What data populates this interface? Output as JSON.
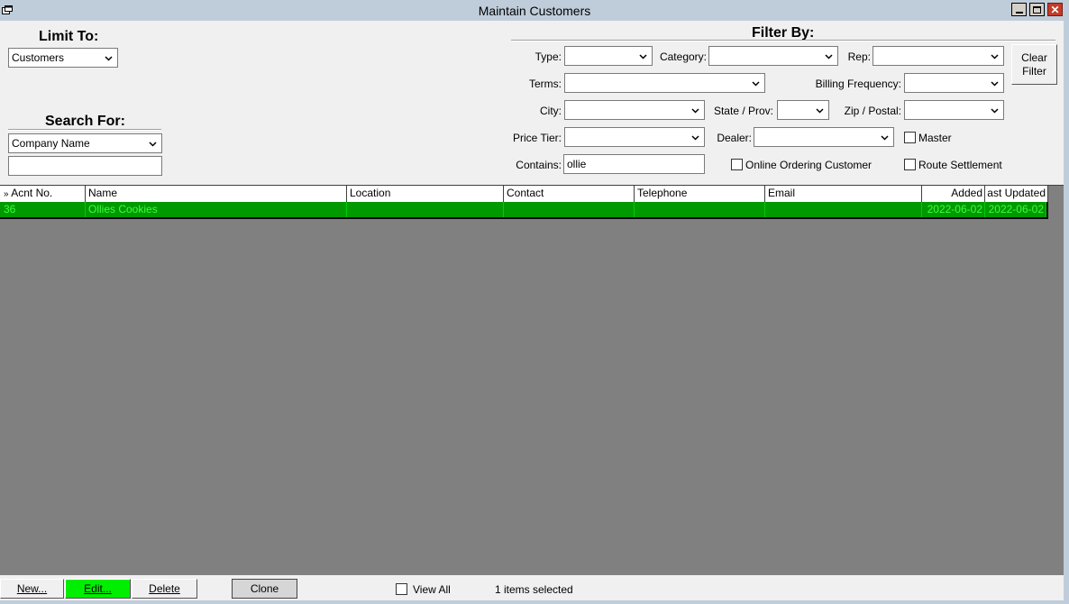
{
  "window": {
    "title": "Maintain Customers"
  },
  "limit_to": {
    "heading": "Limit To:",
    "value": "Customers"
  },
  "search_for": {
    "heading": "Search For:",
    "field": "Company Name",
    "value": ""
  },
  "filter_by": {
    "heading": "Filter By:",
    "type_label": "Type:",
    "type_value": "",
    "category_label": "Category:",
    "category_value": "",
    "rep_label": "Rep:",
    "rep_value": "",
    "terms_label": "Terms:",
    "terms_value": "",
    "billing_frequency_label": "Billing Frequency:",
    "billing_frequency_value": "",
    "city_label": "City:",
    "city_value": "",
    "state_label": "State / Prov:",
    "state_value": "",
    "zip_label": "Zip / Postal:",
    "zip_value": "",
    "price_tier_label": "Price Tier:",
    "price_tier_value": "",
    "dealer_label": "Dealer:",
    "dealer_value": "",
    "master_label": "Master",
    "contains_label": "Contains:",
    "contains_value": "ollie",
    "online_ordering_label": "Online Ordering Customer",
    "route_settlement_label": "Route Settlement",
    "clear_filter_label_1": "Clear",
    "clear_filter_label_2": "Filter"
  },
  "grid": {
    "row_indicator": "»",
    "columns": [
      "Acnt No.",
      "Name",
      "Location",
      "Contact",
      "Telephone",
      "Email",
      "Added",
      "ast Updated"
    ],
    "rows": [
      [
        "36",
        "Ollies Cookies",
        "",
        "",
        "",
        "",
        "2022-06-02",
        "2022-06-02"
      ]
    ]
  },
  "footer": {
    "new_label": "New...",
    "edit_label": "Edit...",
    "delete_label": "Delete",
    "clone_label": "Clone",
    "view_all_label": "View All",
    "status": "1 items selected"
  },
  "colors": {
    "selected_row": "#009900",
    "selected_text": "#3cff3c",
    "edit_button": "#00ee00"
  }
}
